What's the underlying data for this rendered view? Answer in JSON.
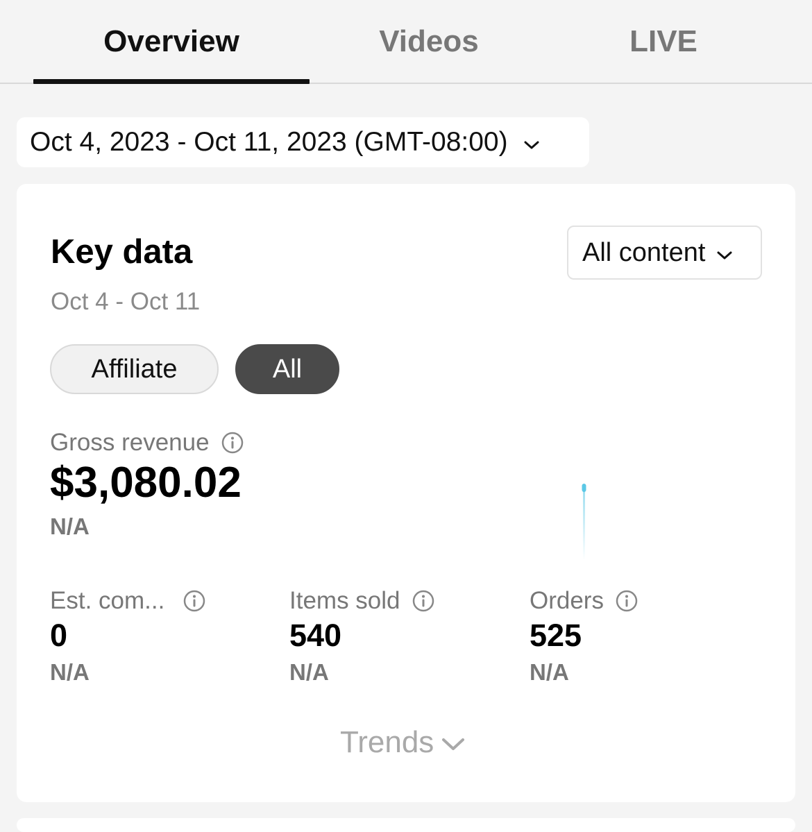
{
  "tabs": [
    {
      "label": "Overview",
      "active": true
    },
    {
      "label": "Videos",
      "active": false
    },
    {
      "label": "LIVE",
      "active": false
    }
  ],
  "date_range": {
    "label": "Oct 4, 2023 - Oct 11, 2023 (GMT-08:00)",
    "icon": "chevron-down-icon"
  },
  "key_data": {
    "title": "Key data",
    "subtitle": "Oct 4 - Oct 11",
    "content_filter": {
      "label": "All content",
      "icon": "chevron-down-icon"
    },
    "segments": [
      {
        "label": "Affiliate",
        "selected": false
      },
      {
        "label": "All",
        "selected": true
      }
    ],
    "gross_revenue": {
      "label": "Gross revenue",
      "value": "$3,080.02",
      "change": "N/A",
      "icon": "info-icon"
    },
    "metrics": [
      {
        "label": "Est. com...",
        "value": "0",
        "change": "N/A",
        "icon": "info-icon"
      },
      {
        "label": "Items sold",
        "value": "540",
        "change": "N/A",
        "icon": "info-icon"
      },
      {
        "label": "Orders",
        "value": "525",
        "change": "N/A",
        "icon": "info-icon"
      }
    ],
    "trends": {
      "label": "Trends",
      "icon": "chevron-down-icon"
    }
  },
  "colors": {
    "accent": "#111111",
    "sparkline": "#5bc8e6",
    "selected_pill": "#4a4a4a"
  }
}
